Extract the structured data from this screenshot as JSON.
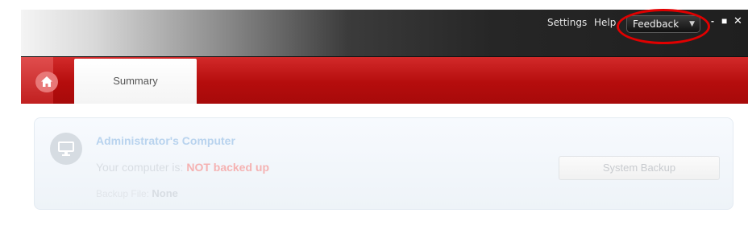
{
  "titlebar": {
    "menu": [
      {
        "label": "Settings"
      },
      {
        "label": "Help"
      }
    ],
    "feedback_label": "Feedback",
    "window_controls": {
      "minimize": "-",
      "maximize": "■",
      "close": "✕"
    }
  },
  "tabs": {
    "home_icon": "home-icon",
    "items": [
      {
        "label": "Summary",
        "active": true
      }
    ]
  },
  "computer": {
    "name": "Administrator's Computer",
    "status_prefix": "Your computer is:",
    "status_value": "NOT backed up",
    "backup_file_label": "Backup File:",
    "backup_file_value": "None",
    "icon": "monitor-icon"
  },
  "actions": {
    "system_backup_label": "System Backup"
  },
  "colors": {
    "accent_red": "#b50d0d",
    "annotation_red": "#e00000",
    "status_alert": "#f5b2b2",
    "computer_name": "#b8d3ee"
  }
}
